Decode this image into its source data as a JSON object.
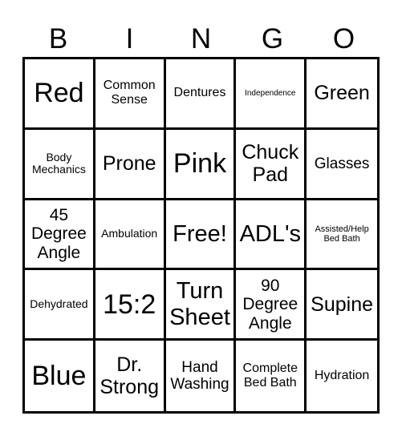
{
  "header": [
    "B",
    "I",
    "N",
    "G",
    "O"
  ],
  "cells": [
    {
      "text": "Red",
      "size": "s-xl"
    },
    {
      "text": "Common Sense",
      "size": "s-s"
    },
    {
      "text": "Dentures",
      "size": "s-s"
    },
    {
      "text": "Independence",
      "size": "s-tiny"
    },
    {
      "text": "Green",
      "size": "s-ml"
    },
    {
      "text": "Body Mechanics",
      "size": "s-xs"
    },
    {
      "text": "Prone",
      "size": "s-ml"
    },
    {
      "text": "Pink",
      "size": "s-xl"
    },
    {
      "text": "Chuck Pad",
      "size": "s-ml"
    },
    {
      "text": "Glasses",
      "size": "s-sm"
    },
    {
      "text": "45 Degree Angle",
      "size": "s-m"
    },
    {
      "text": "Ambulation",
      "size": "s-xs"
    },
    {
      "text": "Free!",
      "size": "s-l"
    },
    {
      "text": "ADL's",
      "size": "s-l"
    },
    {
      "text": "Assisted/Help Bed Bath",
      "size": "s-xxs"
    },
    {
      "text": "Dehydrated",
      "size": "s-xs"
    },
    {
      "text": "15:2",
      "size": "s-xl"
    },
    {
      "text": "Turn Sheet",
      "size": "s-l"
    },
    {
      "text": "90 Degree Angle",
      "size": "s-m"
    },
    {
      "text": "Supine",
      "size": "s-ml"
    },
    {
      "text": "Blue",
      "size": "s-xl"
    },
    {
      "text": "Dr. Strong",
      "size": "s-ml"
    },
    {
      "text": "Hand Washing",
      "size": "s-sm"
    },
    {
      "text": "Complete Bed Bath",
      "size": "s-s"
    },
    {
      "text": "Hydration",
      "size": "s-s"
    }
  ]
}
